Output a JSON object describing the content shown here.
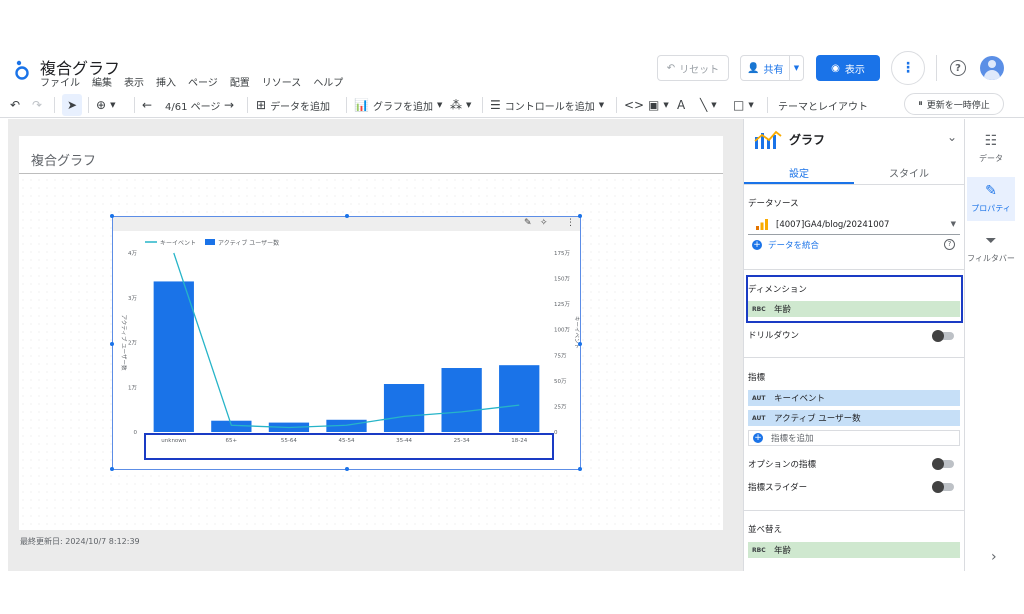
{
  "app": {
    "title": "複合グラフ",
    "menu": [
      "ファイル",
      "編集",
      "表示",
      "挿入",
      "ページ",
      "配置",
      "リソース",
      "ヘルプ"
    ],
    "reset_label": "リセット",
    "share_label": "共有",
    "view_label": "表示"
  },
  "toolbar": {
    "page_indicator": "4/61 ページ",
    "add_data": "データを追加",
    "add_chart": "グラフを追加",
    "add_control": "コントロールを追加",
    "theme_layout": "テーマとレイアウト",
    "pause_updates": "更新を一時停止"
  },
  "canvas": {
    "page_title": "複合グラフ",
    "last_updated": "最終更新日: 2024/10/7 8:12:39"
  },
  "chart_data": {
    "type": "bar",
    "title": "",
    "categories": [
      "unknown",
      "65+",
      "55-64",
      "45-54",
      "35-44",
      "25-34",
      "18-24"
    ],
    "series": [
      {
        "name": "キーイベント",
        "type": "line",
        "axis": "left",
        "values": [
          40000,
          1500,
          1000,
          1500,
          3500,
          4500,
          6000
        ],
        "color": "#26b4c8"
      },
      {
        "name": "アクティブ ユーザー数",
        "type": "bar",
        "axis": "right",
        "values": [
          160000,
          12000,
          10000,
          13000,
          51000,
          68000,
          71000
        ],
        "color": "#1a73e8"
      }
    ],
    "left_axis": {
      "label": "アクティブ ユーザー数",
      "ticks": [
        "0",
        "1万",
        "2万",
        "3万",
        "4万"
      ],
      "ylim": [
        0,
        40000
      ]
    },
    "right_axis": {
      "label": "キーイベント",
      "ticks": [
        "0",
        "25万",
        "50万",
        "75万",
        "100万",
        "125万",
        "150万",
        "175万"
      ],
      "ylim": [
        0,
        175
      ]
    },
    "legend_position": "top-left"
  },
  "panel": {
    "title": "グラフ",
    "tabs": [
      "設定",
      "スタイル"
    ],
    "data_source_label": "データソース",
    "data_source": "[4007]GA4/blog/20241007",
    "blend_data": "データを統合",
    "dimension_label": "ディメンション",
    "dimension_type": "RBC",
    "dimension": "年齢",
    "drilldown_label": "ドリルダウン",
    "metrics_label": "指標",
    "metrics": [
      {
        "type": "AUT",
        "name": "キーイベント"
      },
      {
        "type": "AUT",
        "name": "アクティブ ユーザー数"
      }
    ],
    "add_metric": "指標を追加",
    "optional_metrics": "オプションの指標",
    "metric_slider": "指標スライダー",
    "sort_label": "並べ替え",
    "sort_type": "RBC",
    "sort_field": "年齢"
  },
  "side_tabs": {
    "data": "データ",
    "properties": "プロパティ",
    "filter": "フィルタバー"
  },
  "colors": {
    "accent": "#1a73e8",
    "bar": "#1a73e8",
    "line": "#26b4c8",
    "dimension_chip": "#cfe8cf",
    "metric_chip": "#c6dff7",
    "highlight_box": "#1a3bc4"
  }
}
